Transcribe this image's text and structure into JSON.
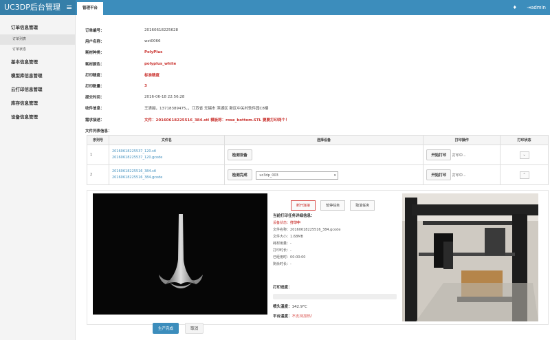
{
  "app": {
    "title": "UC3DP后台管理",
    "menu_icon": "hamburger-icon"
  },
  "tabs": [
    {
      "label": "管理平台"
    }
  ],
  "user": {
    "name": "admin",
    "notify_icon": "bell-icon",
    "logout_icon": "logout-icon"
  },
  "sidebar": {
    "groups": [
      {
        "label": "订单信息管理",
        "items": [
          {
            "label": "订单列表",
            "active": true
          },
          {
            "label": "订单状态",
            "active": false
          }
        ]
      },
      {
        "label": "基本信息管理",
        "items": []
      },
      {
        "label": "模型库信息管理",
        "items": []
      },
      {
        "label": "云打印信息管理",
        "items": []
      },
      {
        "label": "库存信息管理",
        "items": []
      },
      {
        "label": "设备信息管理",
        "items": []
      }
    ]
  },
  "order": {
    "fields": [
      {
        "label": "订单编号：",
        "value": "20160618225628",
        "highlight": false
      },
      {
        "label": "用户名称：",
        "value": "wzt0066",
        "highlight": false
      },
      {
        "label": "耗材种类：",
        "value": "PolyPlus",
        "highlight": true
      },
      {
        "label": "耗材颜色：",
        "value": "polyplus_white",
        "highlight": true
      },
      {
        "label": "打印精度：",
        "value": "标准精度",
        "highlight": true
      },
      {
        "label": "打印数量：",
        "value": "3",
        "highlight": true
      },
      {
        "label": "提交时间：",
        "value": "2016-06-18 22:56:28",
        "highlight": false
      },
      {
        "label": "收件信息：",
        "value": "王清越，13718389475，，江苏省 无锡市 滨湖区 新区中关村软件园C8楼",
        "highlight": false
      },
      {
        "label": "需求描述：",
        "value": "文件：20160618225516_384.stl 模板称：rose_bottom.STL 要要打印两个！",
        "highlight": true
      }
    ],
    "file_list_label": "文件列表信息："
  },
  "file_table": {
    "headers": [
      "序列号",
      "文件名",
      "选择设备",
      "打印操作",
      "打印状态"
    ],
    "rows": [
      {
        "index": "1",
        "files": [
          "20160618225537_120.stl",
          "20160618225537_120.gcode"
        ],
        "device_button": "检测设备",
        "device_select": "",
        "print_button": "开始打印",
        "print_state": "打印中...",
        "status_icon": "chevron-down-icon",
        "status_glyph": "⌄"
      },
      {
        "index": "2",
        "files": [
          "20160618225516_384.stl",
          "20160618225516_384.gcode"
        ],
        "device_button": "检测完成",
        "device_select": "uc3dp_003",
        "print_button": "开始打印",
        "print_state": "打印中...",
        "status_icon": "chevron-up-icon",
        "status_glyph": "⌃"
      }
    ]
  },
  "task": {
    "buttons": {
      "disconnect": "断开连接",
      "pause": "暂停任务",
      "cancel": "取消任务"
    },
    "title": "当前打印任务详细信息：",
    "lines": [
      {
        "label": "设备状态：",
        "value": "打印中",
        "highlight": true
      },
      {
        "label": "文件名称：",
        "value": "20160618225516_384.gcode",
        "highlight": false
      },
      {
        "label": "文件大小：",
        "value": "1.68MB",
        "highlight": false
      },
      {
        "label": "耗材用量：",
        "value": "-",
        "highlight": false
      },
      {
        "label": "打印时长：",
        "value": "-",
        "highlight": false
      },
      {
        "label": "已经用时：",
        "value": "00:00:00",
        "highlight": false
      },
      {
        "label": "剩余时长：",
        "value": "-",
        "highlight": false
      }
    ],
    "progress_label": "打印进度：",
    "progress_fraction": 0.0,
    "nozzle_label": "喷头温度：",
    "nozzle_value": "142.9°C",
    "bed_label": "平台温度：",
    "bed_value": "不支持加热！"
  },
  "footer": {
    "confirm": "生产完成",
    "cancel": "取消"
  },
  "colors": {
    "primary": "#3c8dbc",
    "danger": "#c9302c",
    "sidebar_bg": "#f4f4f4"
  }
}
